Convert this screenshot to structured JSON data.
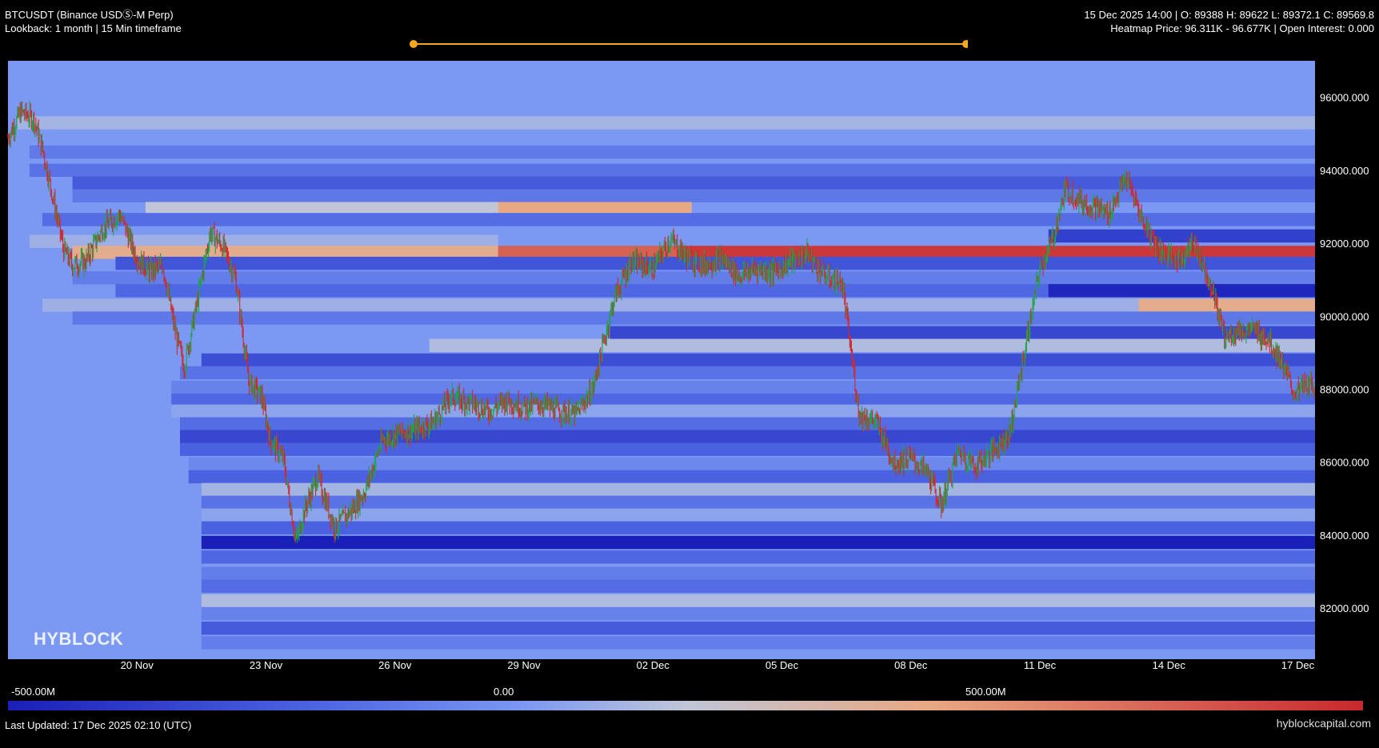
{
  "header": {
    "symbol": "BTCUSDT (Binance USDⓈ-M Perp)",
    "subtitle": "Lookback: 1 month | 15 Min timeframe",
    "ohlc": "15 Dec 2025 14:00 | O: 89388 H: 89622 L: 89372.1 C: 89569.8",
    "info": "Heatmap Price: 96.311K - 96.677K | Open Interest: 0.000"
  },
  "watermark": "HYBLOCK",
  "colorbar": {
    "min_label": "-500.00M",
    "mid_label": "0.00",
    "max_label": "500.00M"
  },
  "footer": {
    "updated": "Last Updated: 17 Dec 2025 02:10 (UTC)",
    "credit": "hyblockcapital.com"
  },
  "colors": {
    "up": "#1fa24a",
    "down": "#d0282e",
    "background": "#7b98f2",
    "page": "#000000"
  },
  "chart_data": {
    "type": "heatmap",
    "title": "BTCUSDT (Binance USDⓈ-M Perp)",
    "ylim": [
      80600,
      97000
    ],
    "y_ticks": [
      "96000.000",
      "94000.000",
      "92000.000",
      "90000.000",
      "88000.000",
      "86000.000",
      "84000.000",
      "82000.000"
    ],
    "y_tick_values": [
      96000,
      94000,
      92000,
      90000,
      88000,
      86000,
      84000,
      82000
    ],
    "x_ticks": [
      "20 Nov",
      "23 Nov",
      "26 Nov",
      "29 Nov",
      "02 Dec",
      "05 Dec",
      "08 Dec",
      "11 Dec",
      "14 Dec",
      "17 Dec"
    ],
    "x_tick_days": [
      3,
      6,
      9,
      12,
      15,
      18,
      21,
      24,
      27,
      30
    ],
    "x_range_days": [
      0,
      30.4
    ],
    "legend_position": "bottom",
    "heat_bands": [
      {
        "price": 95300,
        "start": 0.2,
        "end": 30.4,
        "value": 0.12
      },
      {
        "price": 94500,
        "start": 0.5,
        "end": 30.4,
        "value": -0.28
      },
      {
        "price": 94000,
        "start": 0.5,
        "end": 30.4,
        "value": -0.35
      },
      {
        "price": 93650,
        "start": 1.5,
        "end": 30.4,
        "value": -0.55
      },
      {
        "price": 93300,
        "start": 1.5,
        "end": 30.4,
        "value": -0.3
      },
      {
        "price": 92950,
        "start": 3.2,
        "end": 15.9,
        "value": 0.2
      },
      {
        "price": 92950,
        "start": 11.4,
        "end": 15.9,
        "value": 0.6
      },
      {
        "price": 92650,
        "start": 0.8,
        "end": 30.4,
        "value": -0.4
      },
      {
        "price": 92200,
        "start": 24.2,
        "end": 30.4,
        "value": -0.75
      },
      {
        "price": 92050,
        "start": 0.5,
        "end": 11.4,
        "value": 0.1
      },
      {
        "price": 91750,
        "start": 1.5,
        "end": 11.4,
        "value": 0.55
      },
      {
        "price": 91750,
        "start": 11.4,
        "end": 15.6,
        "value": 0.82
      },
      {
        "price": 91750,
        "start": 15.6,
        "end": 30.4,
        "value": 0.95
      },
      {
        "price": 91450,
        "start": 2.5,
        "end": 30.4,
        "value": -0.6
      },
      {
        "price": 91050,
        "start": 1.5,
        "end": 30.4,
        "value": -0.25
      },
      {
        "price": 90700,
        "start": 2.5,
        "end": 30.4,
        "value": -0.45
      },
      {
        "price": 90700,
        "start": 24.2,
        "end": 30.4,
        "value": -0.95
      },
      {
        "price": 90300,
        "start": 0.8,
        "end": 30.4,
        "value": 0.1
      },
      {
        "price": 90300,
        "start": 26.3,
        "end": 30.4,
        "value": 0.55
      },
      {
        "price": 89950,
        "start": 1.5,
        "end": 30.4,
        "value": -0.3
      },
      {
        "price": 89550,
        "start": 14.0,
        "end": 30.4,
        "value": -0.7
      },
      {
        "price": 89200,
        "start": 9.8,
        "end": 30.4,
        "value": 0.15
      },
      {
        "price": 88800,
        "start": 4.5,
        "end": 30.4,
        "value": -0.65
      },
      {
        "price": 88450,
        "start": 4.0,
        "end": 30.4,
        "value": -0.35
      },
      {
        "price": 88050,
        "start": 3.8,
        "end": 30.4,
        "value": -0.2
      },
      {
        "price": 87700,
        "start": 3.8,
        "end": 30.4,
        "value": -0.45
      },
      {
        "price": 87400,
        "start": 3.8,
        "end": 30.4,
        "value": 0.05
      },
      {
        "price": 87050,
        "start": 4.0,
        "end": 30.4,
        "value": -0.4
      },
      {
        "price": 86700,
        "start": 4.0,
        "end": 30.4,
        "value": -0.7
      },
      {
        "price": 86350,
        "start": 4.0,
        "end": 30.4,
        "value": -0.5
      },
      {
        "price": 85950,
        "start": 4.2,
        "end": 30.4,
        "value": -0.15
      },
      {
        "price": 85600,
        "start": 4.2,
        "end": 30.4,
        "value": -0.5
      },
      {
        "price": 85250,
        "start": 4.5,
        "end": 30.4,
        "value": 0.12
      },
      {
        "price": 84900,
        "start": 4.5,
        "end": 30.4,
        "value": -0.35
      },
      {
        "price": 84550,
        "start": 4.5,
        "end": 30.4,
        "value": 0.05
      },
      {
        "price": 84200,
        "start": 4.5,
        "end": 30.4,
        "value": -0.5
      },
      {
        "price": 83800,
        "start": 4.5,
        "end": 30.4,
        "value": -1.0
      },
      {
        "price": 83400,
        "start": 4.5,
        "end": 30.4,
        "value": -0.45
      },
      {
        "price": 82950,
        "start": 4.5,
        "end": 30.4,
        "value": -0.25
      },
      {
        "price": 82600,
        "start": 4.5,
        "end": 30.4,
        "value": -0.4
      },
      {
        "price": 82200,
        "start": 4.5,
        "end": 30.4,
        "value": 0.15
      },
      {
        "price": 81850,
        "start": 4.5,
        "end": 30.4,
        "value": -0.2
      },
      {
        "price": 81450,
        "start": 4.5,
        "end": 30.4,
        "value": -0.55
      },
      {
        "price": 81050,
        "start": 4.5,
        "end": 30.4,
        "value": -0.25
      }
    ],
    "price_path": [
      [
        0.0,
        94900
      ],
      [
        0.3,
        95600
      ],
      [
        0.6,
        95400
      ],
      [
        0.8,
        94600
      ],
      [
        1.0,
        93500
      ],
      [
        1.3,
        91800
      ],
      [
        1.5,
        91400
      ],
      [
        1.8,
        91500
      ],
      [
        2.2,
        92400
      ],
      [
        2.6,
        92800
      ],
      [
        3.0,
        91600
      ],
      [
        3.3,
        91200
      ],
      [
        3.6,
        91400
      ],
      [
        3.9,
        89500
      ],
      [
        4.1,
        88600
      ],
      [
        4.4,
        90400
      ],
      [
        4.7,
        92300
      ],
      [
        5.0,
        91900
      ],
      [
        5.3,
        91000
      ],
      [
        5.6,
        88200
      ],
      [
        5.9,
        87800
      ],
      [
        6.1,
        86600
      ],
      [
        6.4,
        86100
      ],
      [
        6.7,
        83800
      ],
      [
        6.9,
        84700
      ],
      [
        7.2,
        85600
      ],
      [
        7.6,
        84200
      ],
      [
        8.0,
        84700
      ],
      [
        8.3,
        85200
      ],
      [
        8.7,
        86600
      ],
      [
        9.1,
        86800
      ],
      [
        9.5,
        86900
      ],
      [
        9.9,
        87100
      ],
      [
        10.3,
        87800
      ],
      [
        10.8,
        87600
      ],
      [
        11.2,
        87400
      ],
      [
        11.6,
        87700
      ],
      [
        12.0,
        87500
      ],
      [
        12.4,
        87600
      ],
      [
        12.8,
        87400
      ],
      [
        13.2,
        87300
      ],
      [
        13.6,
        88000
      ],
      [
        14.1,
        90500
      ],
      [
        14.5,
        91500
      ],
      [
        15.0,
        91300
      ],
      [
        15.4,
        92100
      ],
      [
        15.8,
        91600
      ],
      [
        16.2,
        91400
      ],
      [
        16.6,
        91600
      ],
      [
        17.0,
        91100
      ],
      [
        17.4,
        91300
      ],
      [
        17.8,
        91200
      ],
      [
        18.2,
        91500
      ],
      [
        18.6,
        91700
      ],
      [
        19.0,
        91100
      ],
      [
        19.4,
        90900
      ],
      [
        19.8,
        87300
      ],
      [
        20.2,
        87100
      ],
      [
        20.6,
        86000
      ],
      [
        21.0,
        86100
      ],
      [
        21.4,
        85700
      ],
      [
        21.7,
        84800
      ],
      [
        22.1,
        86300
      ],
      [
        22.5,
        85900
      ],
      [
        22.9,
        86300
      ],
      [
        23.3,
        86800
      ],
      [
        23.7,
        89400
      ],
      [
        24.0,
        91300
      ],
      [
        24.3,
        92100
      ],
      [
        24.6,
        93500
      ],
      [
        25.0,
        93100
      ],
      [
        25.3,
        93000
      ],
      [
        25.6,
        92800
      ],
      [
        26.0,
        93800
      ],
      [
        26.4,
        92600
      ],
      [
        26.8,
        91800
      ],
      [
        27.2,
        91500
      ],
      [
        27.6,
        92000
      ],
      [
        28.0,
        90800
      ],
      [
        28.3,
        89400
      ],
      [
        28.6,
        89600
      ],
      [
        29.0,
        89600
      ],
      [
        29.3,
        89400
      ],
      [
        29.6,
        88800
      ],
      [
        29.9,
        87900
      ],
      [
        30.2,
        88100
      ],
      [
        30.4,
        88100
      ]
    ]
  }
}
